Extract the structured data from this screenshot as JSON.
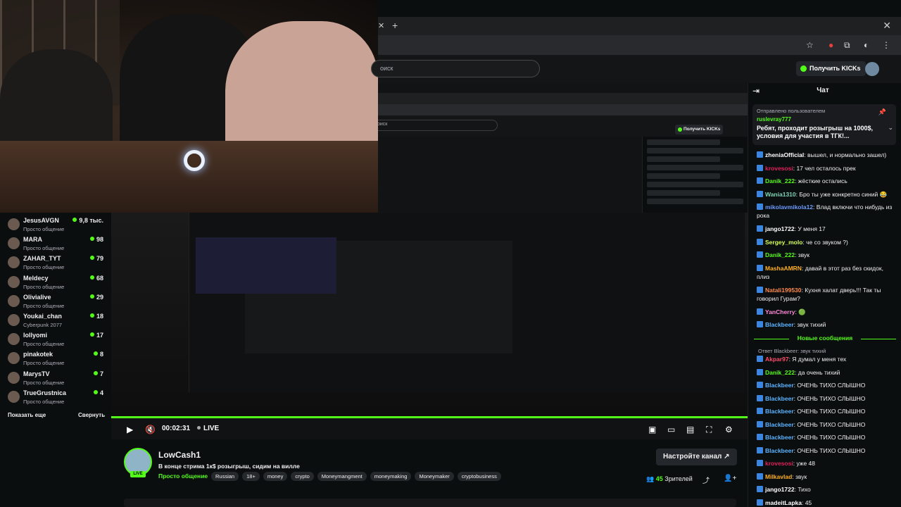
{
  "browser": {
    "tab_close": "✕",
    "new_tab": "+",
    "window_close": "✕"
  },
  "header": {
    "search_placeholder": "оиск",
    "get_kicks": "Получить KICKs"
  },
  "sidebar": {
    "channels": [
      {
        "name": "JesusAVGN",
        "game": "Просто общение",
        "viewers": "9,8 тыс."
      },
      {
        "name": "MARA",
        "game": "Просто общение",
        "viewers": "98"
      },
      {
        "name": "ZAHAR_TYT",
        "game": "Просто общение",
        "viewers": "79"
      },
      {
        "name": "Meldecy",
        "game": "Просто общение",
        "viewers": "68"
      },
      {
        "name": "Olivialive",
        "game": "Просто общение",
        "viewers": "29"
      },
      {
        "name": "Youkai_chan",
        "game": "Cyberpunk 2077",
        "viewers": "18"
      },
      {
        "name": "lollyomi",
        "game": "Просто общение",
        "viewers": "17"
      },
      {
        "name": "pinakotek",
        "game": "Просто общение",
        "viewers": "8"
      },
      {
        "name": "MarysTV",
        "game": "Просто общение",
        "viewers": "7"
      },
      {
        "name": "TrueGrustnica",
        "game": "Просто общение",
        "viewers": "4"
      }
    ],
    "show_more": "Показать еще",
    "collapse": "Свернуть"
  },
  "player": {
    "time": "00:02:31",
    "live": "LIVE"
  },
  "stream": {
    "channel": "LowCash1",
    "live_badge": "LIVE",
    "title": "В конце стрима 1к$ розыгрыш, сидим на вилле",
    "category": "Просто общение",
    "tags": [
      "Russian",
      "18+",
      "money",
      "crypto",
      "Moneymangment",
      "moneymaking",
      "Moneymaker",
      "cryptobusiness"
    ],
    "configure_channel": "Настройте канал",
    "viewers_count": "45",
    "viewers_label": "Зрителей"
  },
  "chat": {
    "title": "Чат",
    "pinned": {
      "label": "Отправлено пользователем",
      "user": "ruslevray777",
      "text": "Ребят, проходит розыгрыш на 1000$, условия для участия в ТГК!..."
    },
    "messages": [
      {
        "user": "zheniaOfficial",
        "color": "#ffffff",
        "text": "вышел, и нормально зашел)"
      },
      {
        "user": "krovesosi",
        "color": "#e0215c",
        "text": "17 чел осталось прек"
      },
      {
        "user": "Danik_222",
        "color": "#53fc18",
        "text": "жёсткие остались"
      },
      {
        "user": "Wania1310",
        "color": "#7dd3b4",
        "text": "Бро ты уже конкретно синий 😂"
      },
      {
        "user": "mikolavmikola12",
        "color": "#6a9bff",
        "text": "Влад включи что нибудь из рока"
      },
      {
        "user": "jango1722",
        "color": "#ffffff",
        "text": "У меня 17"
      },
      {
        "user": "Sergey_molo",
        "color": "#d6ff5a",
        "text": "че со звуком ?)"
      },
      {
        "user": "Danik_222",
        "color": "#53fc18",
        "text": "звук"
      },
      {
        "user": "MashaAMRN",
        "color": "#ffb020",
        "text": "давай в этот раз без скидок, плиз"
      },
      {
        "user": "Natali199530",
        "color": "#ff8a4c",
        "text": "Кухня халат дверь!!! Так ты говорил Гурам?"
      },
      {
        "user": "YanCherry",
        "color": "#ff8ad8",
        "text": "🟢"
      },
      {
        "user": "Blackbeer",
        "color": "#5ab4ff",
        "text": "звук тихий"
      }
    ],
    "new_messages": "Новые сообщения",
    "reply1": "Ответ Blackbeer: звук тихий",
    "messages2": [
      {
        "user": "Akpar97",
        "color": "#ff4a6b",
        "text": "Я думал у меня тех"
      },
      {
        "user": "Danik_222",
        "color": "#53fc18",
        "text": "да очень тихий"
      },
      {
        "user": "Blackbeer",
        "color": "#5ab4ff",
        "text": "ОЧЕНЬ ТИХО СЛЫШНО"
      },
      {
        "user": "Blackbeer",
        "color": "#5ab4ff",
        "text": "ОЧЕНЬ ТИХО СЛЫШНО"
      },
      {
        "user": "Blackbeer",
        "color": "#5ab4ff",
        "text": "ОЧЕНЬ ТИХО СЛЫШНО"
      },
      {
        "user": "Blackbeer",
        "color": "#5ab4ff",
        "text": "ОЧЕНЬ ТИХО СЛЫШНО"
      },
      {
        "user": "Blackbeer",
        "color": "#5ab4ff",
        "text": "ОЧЕНЬ ТИХО СЛЫШНО"
      },
      {
        "user": "Blackbeer",
        "color": "#5ab4ff",
        "text": "ОЧЕНЬ ТИХО СЛЫШНО"
      },
      {
        "user": "krovesosi",
        "color": "#e0215c",
        "text": "уже 48"
      },
      {
        "user": "Milkavlad",
        "color": "#ffb020",
        "text": "звук"
      },
      {
        "user": "jango1722",
        "color": "#ffffff",
        "text": "Тихо"
      },
      {
        "user": "madeitLapka",
        "color": "#ffffff",
        "text": "45"
      }
    ]
  },
  "colors": {
    "accent": "#53fc18",
    "background": "#0b0e0f"
  }
}
